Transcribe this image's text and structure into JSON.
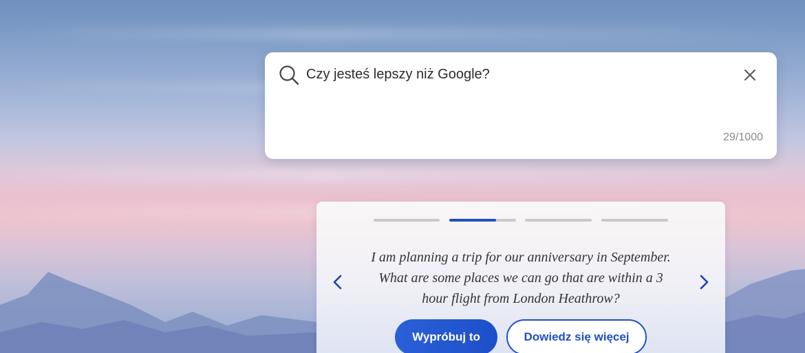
{
  "search": {
    "query": "Czy jesteś lepszy niż Google?",
    "char_count": "29/1000"
  },
  "suggestion_card": {
    "prompt": "I am planning a trip for our anniversary in September. What are some places we can go that are within a 3 hour flight from London Heathrow?",
    "primary_button": "Wypróbuj to",
    "secondary_button": "Dowiedz się więcej",
    "slides_total": 4,
    "active_slide": 2,
    "active_slide_progress": 0.7
  },
  "colors": {
    "accent": "#1d4fc9",
    "progress_track": "#c9c9c9"
  },
  "icons": {
    "search": "search-icon",
    "clear": "close-icon",
    "prev": "chevron-left-icon",
    "next": "chevron-right-icon"
  }
}
